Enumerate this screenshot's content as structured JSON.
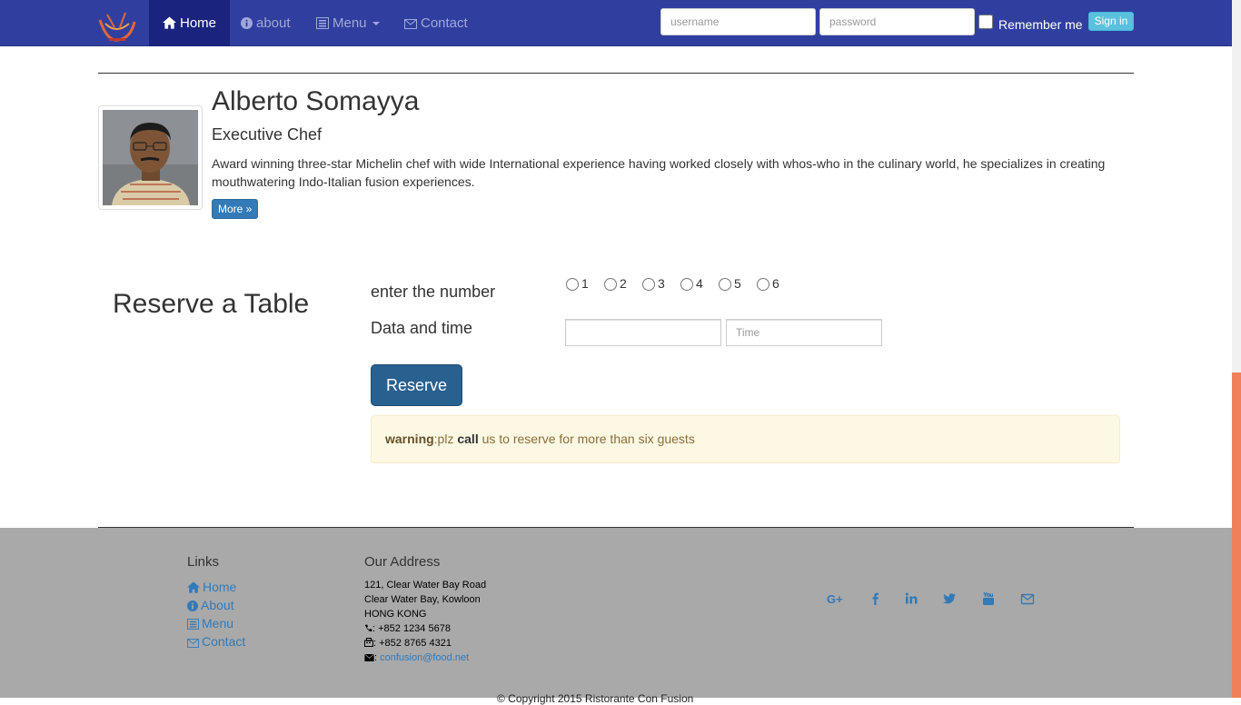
{
  "navbar": {
    "brand_icon": "restaurant-logo",
    "items": [
      {
        "label": "Home",
        "icon": "home-icon",
        "active": true
      },
      {
        "label": "about",
        "icon": "info-circle-icon",
        "active": false
      },
      {
        "label": "Menu",
        "icon": "list-alt-icon",
        "active": false
      },
      {
        "label": "Contact",
        "icon": "envelope-icon",
        "active": false
      }
    ],
    "login": {
      "username_placeholder": "username",
      "password_placeholder": "password",
      "remember_label": "Remember me",
      "remember_checked": false,
      "signin_label": "Sign in"
    }
  },
  "chef": {
    "name": "Alberto Somayya",
    "role": "Executive Chef",
    "description": "Award winning three-star Michelin chef with wide International experience having worked closely with whos-who in the culinary world, he specializes in creating mouthwatering Indo-Italian fusion experiences.",
    "more_label": "More »"
  },
  "reservation": {
    "title": "Reserve a Table",
    "number_label": "enter the number",
    "guest_options": [
      "1",
      "2",
      "3",
      "4",
      "5",
      "6"
    ],
    "datetime_label": "Data and time",
    "date_value": "",
    "time_placeholder": "Time",
    "reserve_label": "Reserve",
    "warning": {
      "prefix": "warning",
      "text1": ":plz ",
      "emphasis": "call",
      "text2": " us to reserve for more than six guests"
    }
  },
  "footer": {
    "links_heading": "Links",
    "links": [
      {
        "label": "Home",
        "icon": "home-icon"
      },
      {
        "label": "About",
        "icon": "info-circle-icon"
      },
      {
        "label": "Menu",
        "icon": "list-alt-icon"
      },
      {
        "label": "Contact",
        "icon": "envelope-icon"
      }
    ],
    "address_heading": "Our Address",
    "address": {
      "line1": "121, Clear Water Bay Road",
      "line2": "Clear Water Bay, Kowloon",
      "line3": "HONG KONG",
      "phone": ": +852 1234 5678",
      "fax": ": +852 8765 4321",
      "email_prefix": ": ",
      "email": "confusion@food.net"
    },
    "social": [
      "google-plus-icon",
      "facebook-icon",
      "linkedin-icon",
      "twitter-icon",
      "youtube-icon",
      "mail-icon"
    ],
    "copyright": "© Copyright 2015 Ristorante Con Fusion"
  },
  "colors": {
    "navbar": "#303f9f",
    "navbar_active": "#1a237e",
    "primary": "#337ab7",
    "footer": "#a9a9a9",
    "warning_bg": "#fcf8e3",
    "scroll_thumb": "#f0805a"
  }
}
